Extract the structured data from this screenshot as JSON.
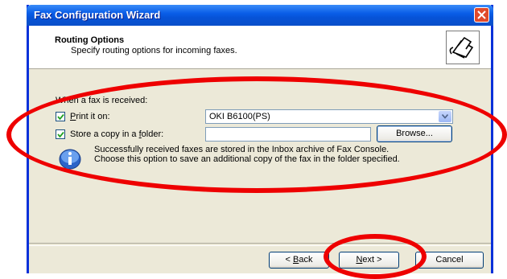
{
  "window": {
    "title": "Fax Configuration Wizard"
  },
  "header": {
    "title": "Routing Options",
    "subtitle": "Specify routing options for incoming faxes."
  },
  "body": {
    "prompt": "When a fax is received:",
    "print": {
      "checked": true,
      "prefix": "",
      "accel": "P",
      "rest": "rint it on:",
      "printer": "OKI B6100(PS)"
    },
    "store": {
      "checked": true,
      "prefix": "Store a copy in a ",
      "accel": "f",
      "rest": "older:",
      "folder": "",
      "browse_label": "Browse..."
    },
    "info_line1": "Successfully received faxes are stored in the Inbox archive of Fax Console.",
    "info_line2": "Choose this option to save an additional copy of the fax in the folder specified."
  },
  "footer": {
    "back": {
      "prefix": "< ",
      "accel": "B",
      "rest": "ack"
    },
    "next": {
      "prefix": "",
      "accel": "N",
      "rest": "ext >"
    },
    "cancel": "Cancel"
  },
  "annotation_color": "#ee0000"
}
